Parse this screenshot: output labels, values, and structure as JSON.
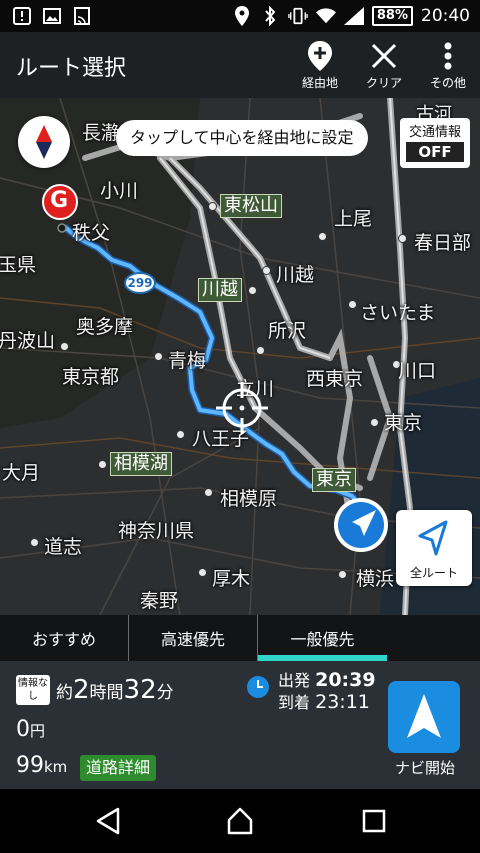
{
  "status_bar": {
    "battery": "88%",
    "time": "20:40",
    "icons": [
      "notification-alert-icon",
      "image-icon",
      "cast-icon",
      "location-icon",
      "bluetooth-icon",
      "vibrate-icon",
      "wifi-icon",
      "signal-icon"
    ]
  },
  "header": {
    "title": "ルート選択",
    "actions": [
      {
        "label": "経由地",
        "icon": "add-waypoint-icon"
      },
      {
        "label": "クリア",
        "icon": "close-icon"
      },
      {
        "label": "その他",
        "icon": "more-vert-icon"
      }
    ]
  },
  "map": {
    "hint": "タップして中心を経由地に設定",
    "traffic": {
      "label": "交通情報",
      "state": "OFF"
    },
    "goal_marker": "G",
    "route_number": "299",
    "places": [
      "長瀞",
      "小川",
      "秩父",
      "玉県",
      "奥多摩",
      "丹波山",
      "東京都",
      "青梅",
      "八王子",
      "大月",
      "相模原",
      "神奈川県",
      "道志",
      "秦野",
      "厚木",
      "横浜",
      "所沢",
      "川越",
      "上尾",
      "春日部",
      "さいたま",
      "川口",
      "西東京",
      "立川",
      "東京",
      "古河"
    ],
    "stations": [
      "東松山",
      "川越",
      "相模湖",
      "東京"
    ],
    "all_route_label": "全ルート",
    "colors": {
      "route": "#4aa8ff",
      "highway": "#a8a8a8",
      "bg": "#2a2c2e"
    }
  },
  "route_tabs": [
    {
      "label": "おすすめ",
      "active": false
    },
    {
      "label": "高速優先",
      "active": false
    },
    {
      "label": "一般優先",
      "active": true
    }
  ],
  "summary": {
    "nodata_badge": "情報なし",
    "duration_prefix": "約",
    "duration_hours": "2",
    "duration_hours_unit": "時間",
    "duration_minutes": "32",
    "duration_minutes_unit": "分",
    "depart_label": "出発",
    "depart_time": "20:39",
    "arrive_label": "到着",
    "arrive_time": "23:11",
    "toll_value": "0",
    "toll_unit": "円",
    "distance_value": "99",
    "distance_unit": "km",
    "detail_button": "道路詳細",
    "nav_start_label": "ナビ開始"
  },
  "nav_bar": [
    "back-icon",
    "home-icon",
    "recents-icon"
  ]
}
